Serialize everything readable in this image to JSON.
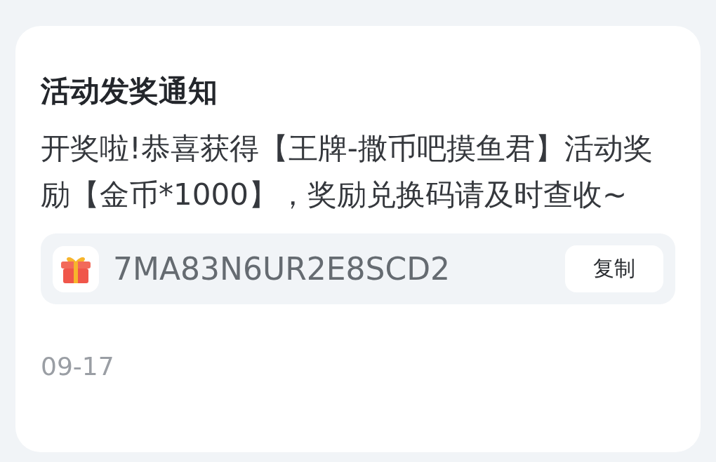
{
  "card": {
    "title": "活动发奖通知",
    "message": "开奖啦!恭喜获得【王牌-撒币吧摸鱼君】活动奖励【金币*1000】，奖励兑换码请及时查收~",
    "code": {
      "value": "7MA83N6UR2E8SCD2",
      "button": "复制"
    },
    "date": "09-17"
  }
}
